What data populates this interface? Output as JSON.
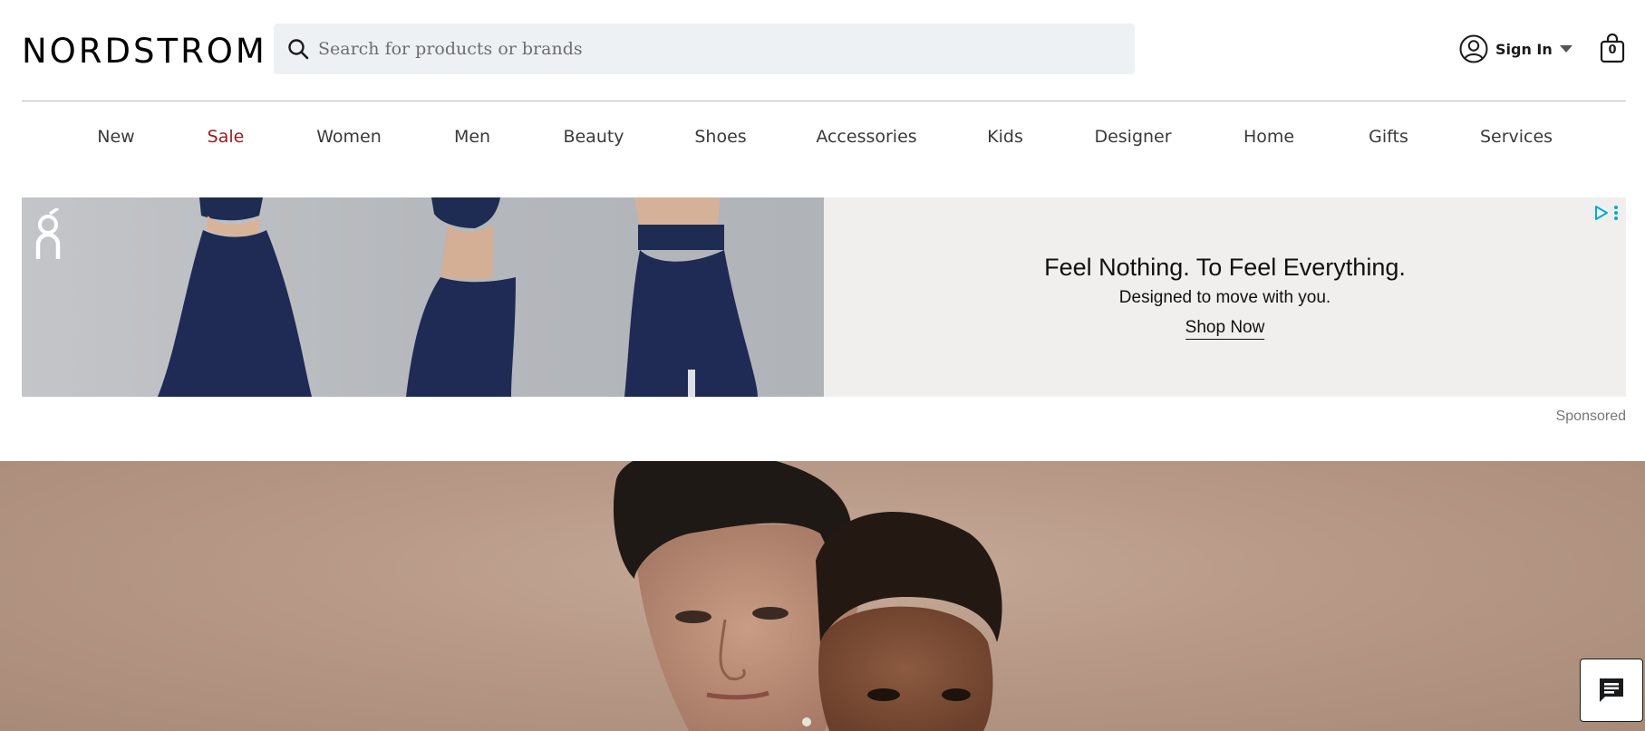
{
  "header": {
    "logo": "NORDSTROM",
    "search": {
      "placeholder": "Search for products or brands",
      "value": ""
    },
    "sign_in_label": "Sign In",
    "bag_count": "0"
  },
  "nav": {
    "items": [
      {
        "label": "New"
      },
      {
        "label": "Sale",
        "color": "#9c1b1b"
      },
      {
        "label": "Women"
      },
      {
        "label": "Men"
      },
      {
        "label": "Beauty"
      },
      {
        "label": "Shoes"
      },
      {
        "label": "Accessories"
      },
      {
        "label": "Kids"
      },
      {
        "label": "Designer"
      },
      {
        "label": "Home"
      },
      {
        "label": "Gifts"
      },
      {
        "label": "Services"
      }
    ]
  },
  "ad": {
    "title": "Feel Nothing. To Feel Everything.",
    "subtitle": "Designed to move with you.",
    "cta": "Shop Now",
    "sponsored_label": "Sponsored",
    "background_color": "#f1efee",
    "adchoices_color": "#00aecd"
  },
  "hero": {
    "background_color": "#b99a88"
  },
  "icons": {
    "search": "search-icon",
    "user": "user-icon",
    "caret": "chevron-down-icon",
    "bag": "shopping-bag-icon",
    "chat": "chat-icon",
    "ad_brand": "on-running-logo",
    "ad_choices": "adchoices-icon"
  }
}
